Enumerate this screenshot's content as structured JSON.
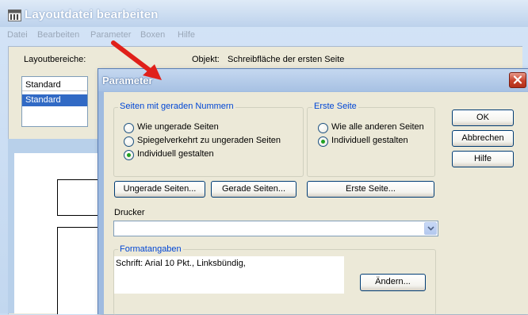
{
  "window": {
    "title": "Layoutdatei bearbeiten",
    "menu": [
      "Datei",
      "Bearbeiten",
      "Parameter",
      "Boxen",
      "Hilfe"
    ]
  },
  "main": {
    "layoutbereiche_label": "Layoutbereiche:",
    "layoutbereiche_items": [
      "Standard",
      "Standard"
    ],
    "selected_item": "Standard",
    "objekt_caption": "Objekt:",
    "objekt_value": "Schreibfläche der ersten Seite"
  },
  "dialog": {
    "title": "Parameter",
    "group_even": {
      "label": "Seiten mit geraden Nummern",
      "options": [
        "Wie ungerade Seiten",
        "Spiegelverkehrt zu ungeraden Seiten",
        "Individuell gestalten"
      ],
      "selected": "Individuell gestalten"
    },
    "group_first": {
      "label": "Erste Seite",
      "options": [
        "Wie alle anderen Seiten",
        "Individuell gestalten"
      ],
      "selected": "Individuell gestalten"
    },
    "buttons": {
      "ok": "OK",
      "abbrechen": "Abbrechen",
      "hilfe": "Hilfe",
      "ungerade": "Ungerade Seiten...",
      "gerade": "Gerade Seiten...",
      "erste": "Erste Seite...",
      "aendern": "Ändern..."
    },
    "drucker_label": "Drucker",
    "drucker_value": "",
    "format_label": "Formatangaben",
    "format_text": "Schrift: Arial 10 Pkt., Linksbündig,"
  },
  "colors": {
    "group_label": "#0046d5",
    "selection": "#316ac5",
    "annotation_arrow": "#e0201a",
    "radio_dot": "#21a121"
  }
}
